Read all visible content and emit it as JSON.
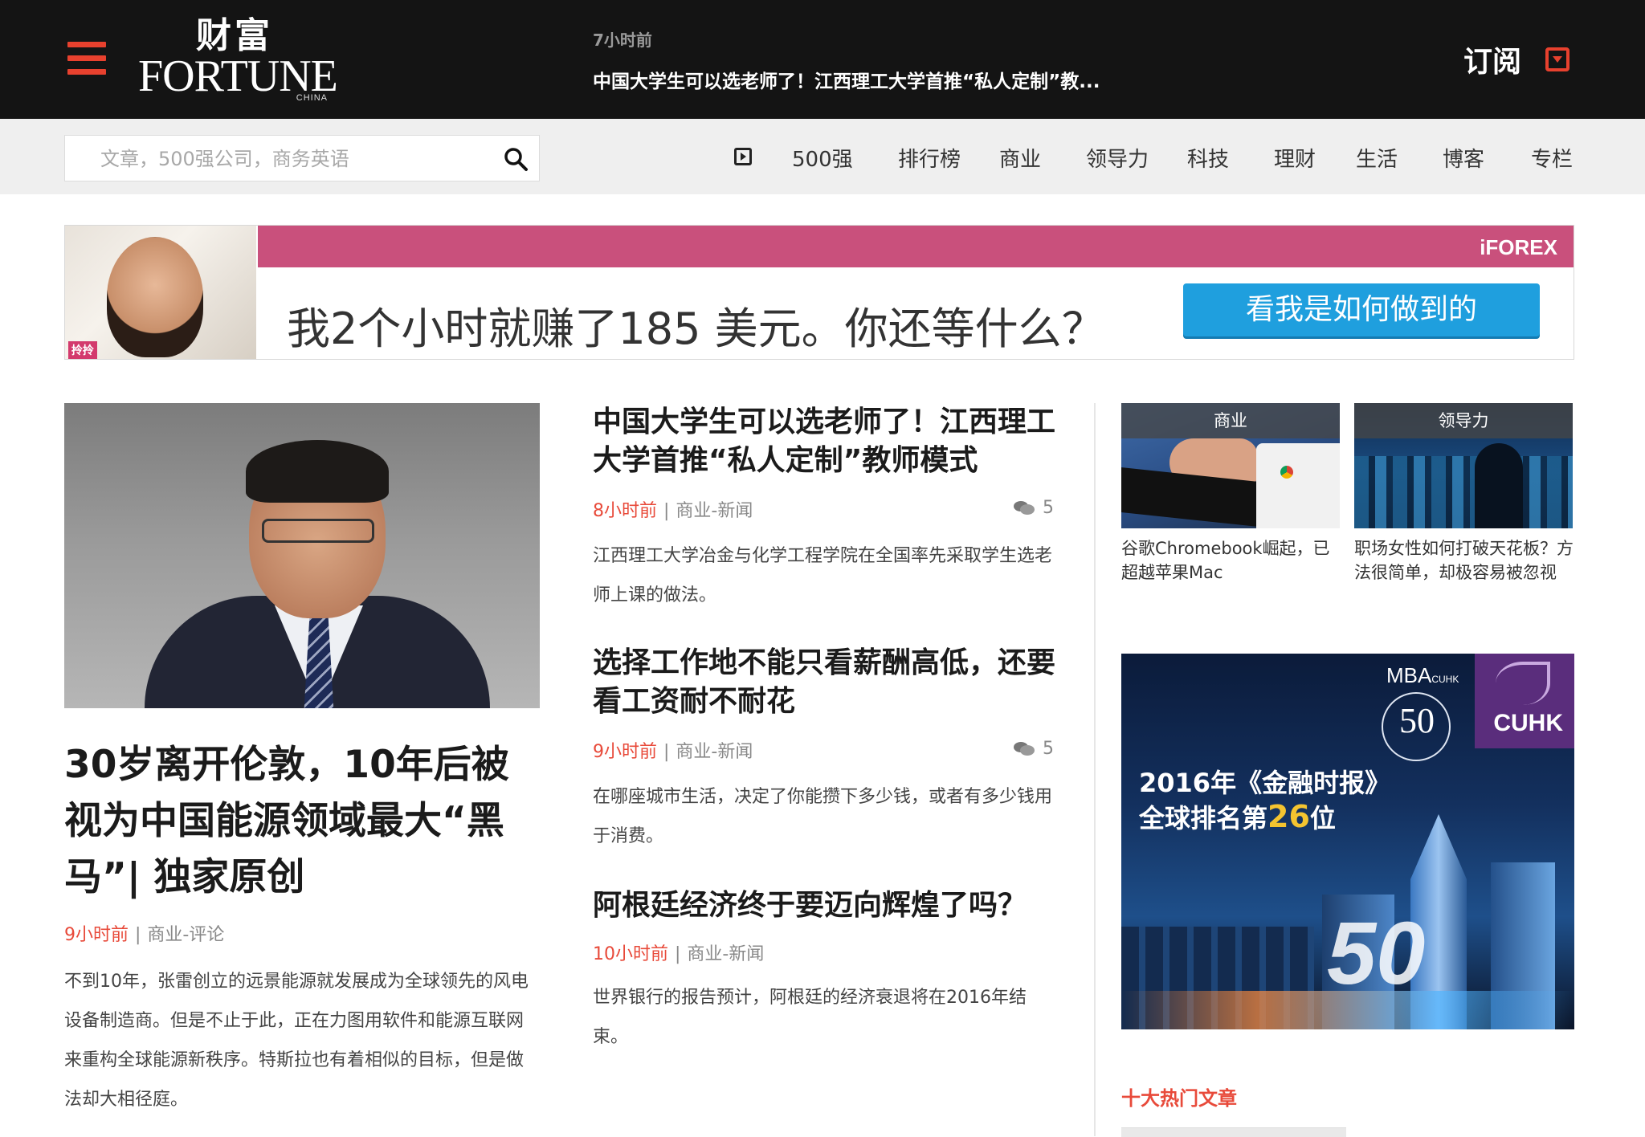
{
  "header": {
    "menu_icon": "hamburger-menu-icon",
    "logo": {
      "cn": "财富",
      "en": "FORTUNE",
      "sub": "CHINA"
    },
    "ticker": {
      "time": "7小时前",
      "title": "中国大学生可以选老师了！江西理工大学首推“私人定制”教..."
    },
    "subscribe_label": "订阅",
    "subscribe_icon": "dropdown-box-icon",
    "accent_color": "#e8412e"
  },
  "nav": {
    "search_placeholder": "文章，500强公司，商务英语",
    "search_icon": "magnifier-icon",
    "video_icon": "play-icon",
    "links": [
      "500强",
      "排行榜",
      "商业",
      "领导力",
      "科技",
      "理财",
      "生活",
      "博客",
      "专栏"
    ]
  },
  "ad_banner": {
    "tag": "拎拎",
    "brand": "iFOREX",
    "headline": "我2个小时就赚了185 美元。你还等什么？",
    "cta": "看我是如何做到的"
  },
  "lead": {
    "title": "30岁离开伦敦，10年后被视为中国能源领域最大“黑马”| 独家原创",
    "time": "9小时前",
    "category": "商业-评论",
    "desc": "不到10年，张雷创立的远景能源就发展成为全球领先的风电设备制造商。但是不止于此，正在力图用软件和能源互联网来重构全球能源新秩序。特斯拉也有着相似的目标，但是做法却大相径庭。"
  },
  "articles": [
    {
      "title": "中国大学生可以选老师了！江西理工大学首推“私人定制”教师模式",
      "time": "8小时前",
      "category": "商业-新闻",
      "comments": "5",
      "desc": "江西理工大学冶金与化学工程学院在全国率先采取学生选老师上课的做法。"
    },
    {
      "title": "选择工作地不能只看薪酬高低，还要看工资耐不耐花",
      "time": "9小时前",
      "category": "商业-新闻",
      "comments": "5",
      "desc": "在哪座城市生活，决定了你能攒下多少钱，或者有多少钱用于消费。"
    },
    {
      "title": "阿根廷经济终于要迈向辉煌了吗？",
      "time": "10小时前",
      "category": "商业-新闻",
      "desc": "世界银行的报告预计，阿根廷的经济衰退将在2016年结束。"
    }
  ],
  "side_thumbs": [
    {
      "caption": "商业",
      "text": "谷歌Chromebook崛起，已超越苹果Mac"
    },
    {
      "caption": "领导力",
      "text": "职场女性如何打破天花板？方法很简单，却极容易被忽视"
    }
  ],
  "side_ad": {
    "mba": "MBA",
    "mba_small": "CUHK",
    "logo": "CUHK",
    "line1": "2016年《金融时报》",
    "line2_prefix": "全球排名第",
    "rank": "26",
    "line2_suffix": "位",
    "big_number": "50",
    "medal_number": "50"
  },
  "hot": {
    "title": "十大热门文章"
  }
}
